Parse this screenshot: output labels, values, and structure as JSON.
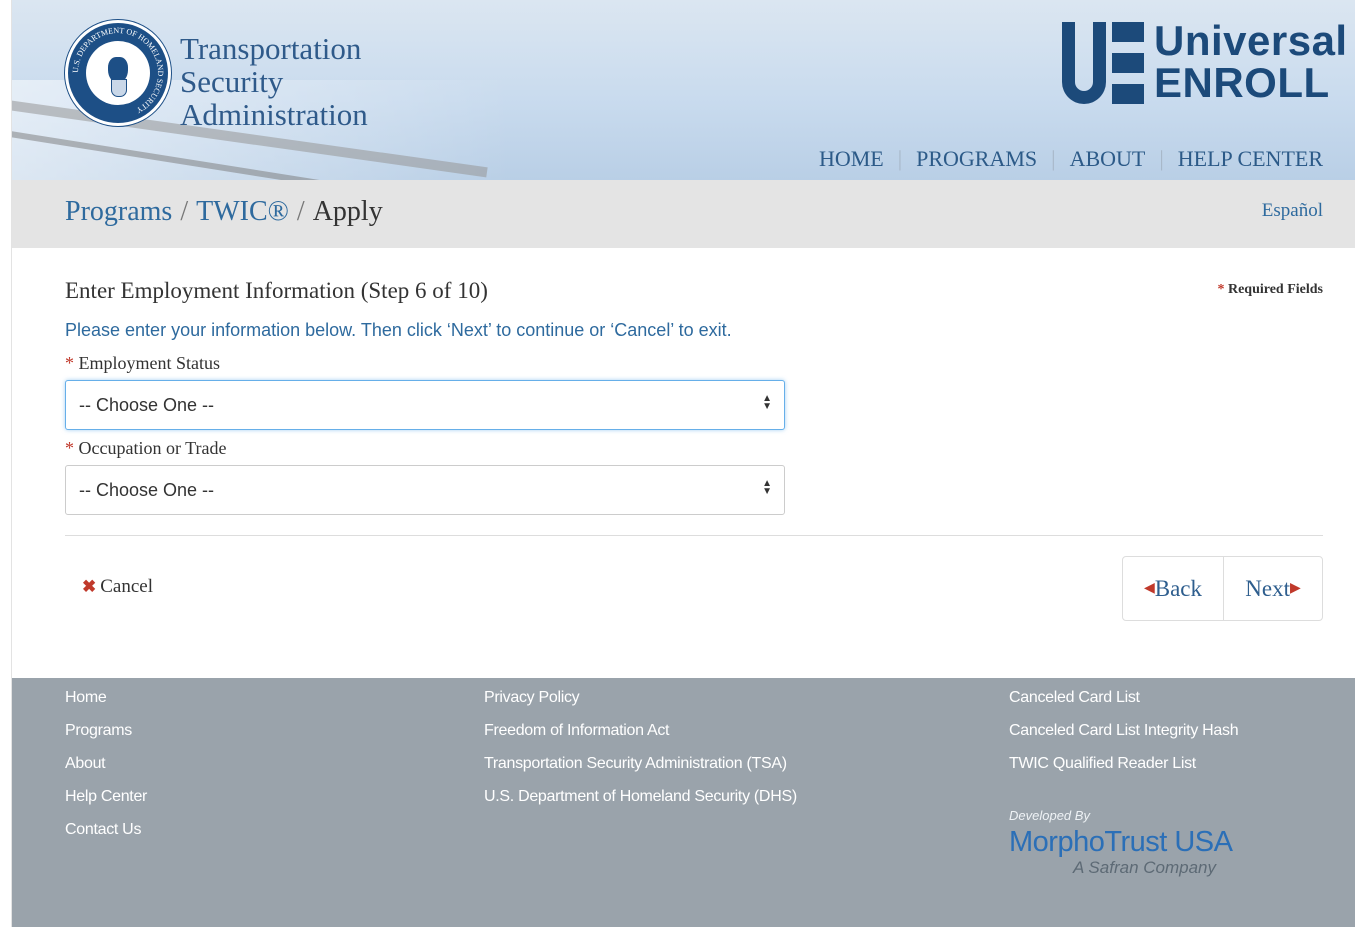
{
  "header": {
    "agency_lines": [
      "Transportation",
      "Security",
      "Administration"
    ],
    "seal_text": "U.S. DEPARTMENT OF HOMELAND SECURITY",
    "brand_line1": "Universal",
    "brand_line2": "ENROLL",
    "nav": [
      "HOME",
      "PROGRAMS",
      "ABOUT",
      "HELP CENTER"
    ]
  },
  "breadcrumb": {
    "items": [
      "Programs",
      "TWIC®",
      "Apply"
    ],
    "separator": "/",
    "language_link": "Español"
  },
  "form": {
    "step_title": "Enter Employment Information (Step 6 of 10)",
    "required_star": "*",
    "required_label": "Required Fields",
    "instructions": "Please enter your information below. Then click ‘Next’ to continue or ‘Cancel’ to exit.",
    "fields": [
      {
        "label": "Employment Status",
        "value": "-- Choose One --"
      },
      {
        "label": "Occupation or Trade",
        "value": "-- Choose One --"
      }
    ],
    "cancel_label": "Cancel",
    "back_label": "Back",
    "next_label": "Next"
  },
  "footer": {
    "col1": [
      "Home",
      "Programs",
      "About",
      "Help Center",
      "Contact Us"
    ],
    "col2": [
      "Privacy Policy",
      "Freedom of Information Act",
      "Transportation Security Administration (TSA)",
      "U.S. Department of Homeland Security (DHS)"
    ],
    "col3": [
      "Canceled Card List",
      "Canceled Card List Integrity Hash",
      "TWIC Qualified Reader List"
    ],
    "developed_by": "Developed By",
    "developer": "MorphoTrust USA",
    "developer_tagline": "A Safran Company"
  },
  "colors": {
    "brand_blue": "#1c4a7a",
    "link_blue": "#2e6a9e",
    "required_red": "#c0392b",
    "footer_gray": "#9aa3ab"
  }
}
